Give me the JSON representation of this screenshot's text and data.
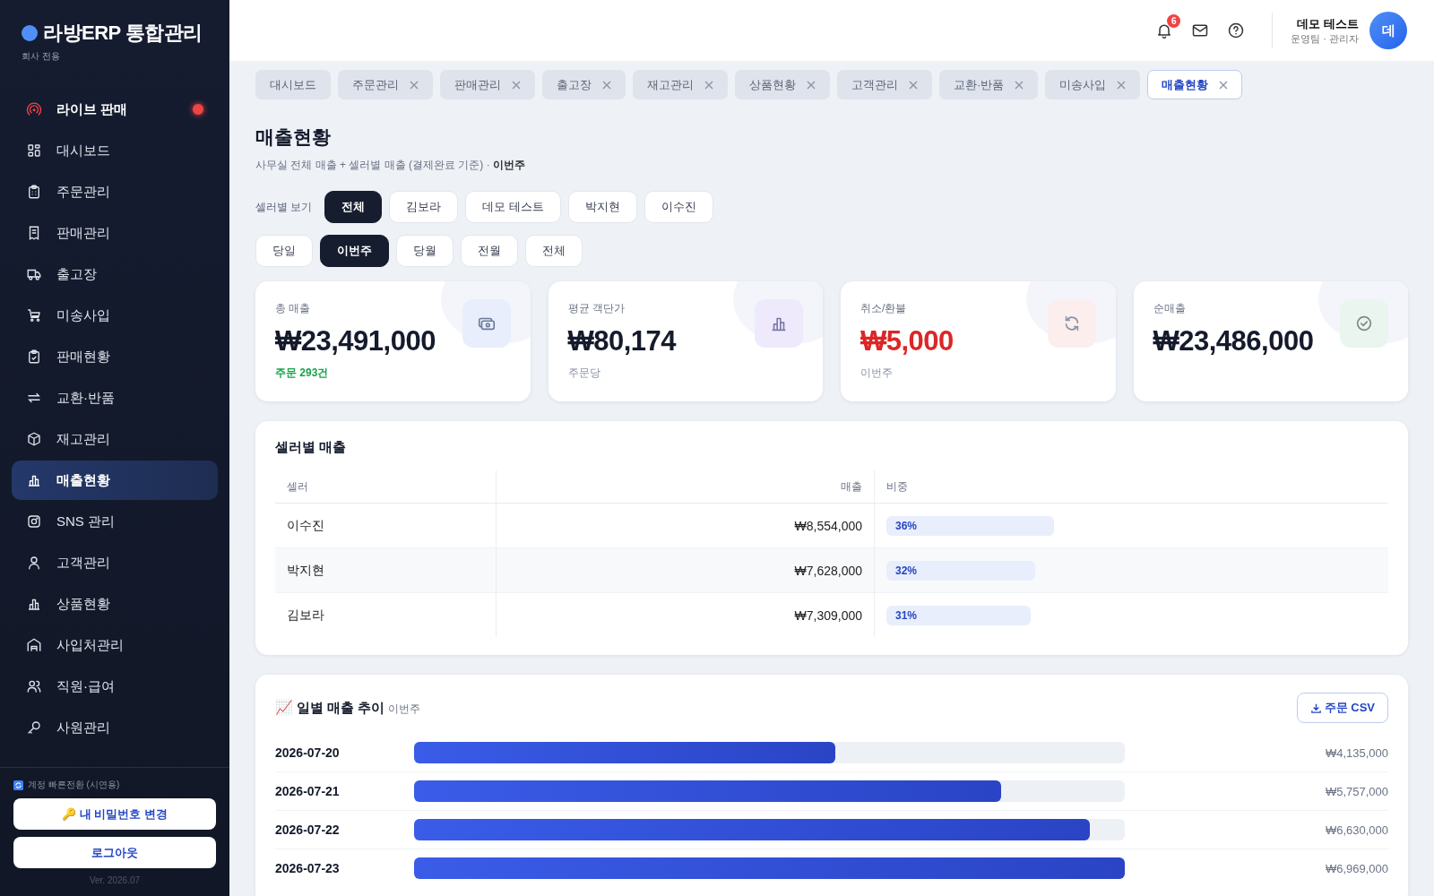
{
  "sidebar": {
    "brand": "라방ERP 통합관리",
    "subtitle": "회사 전용",
    "items": [
      {
        "label": "라이브 판매",
        "kind": "live",
        "selected": false,
        "live": true
      },
      {
        "label": "대시보드",
        "kind": "grid",
        "selected": false
      },
      {
        "label": "주문관리",
        "kind": "clipboard",
        "selected": false
      },
      {
        "label": "판매관리",
        "kind": "receipt",
        "selected": false
      },
      {
        "label": "출고장",
        "kind": "truck",
        "selected": false
      },
      {
        "label": "미송사입",
        "kind": "cart",
        "selected": false
      },
      {
        "label": "판매현황",
        "kind": "check",
        "selected": false
      },
      {
        "label": "교환·반품",
        "kind": "swap",
        "selected": false
      },
      {
        "label": "재고관리",
        "kind": "box",
        "selected": false
      },
      {
        "label": "매출현황",
        "kind": "chart",
        "selected": true
      },
      {
        "label": "SNS 관리",
        "kind": "camera",
        "selected": false
      },
      {
        "label": "고객관리",
        "kind": "person",
        "selected": false
      },
      {
        "label": "상품현황",
        "kind": "chart",
        "selected": false
      },
      {
        "label": "사입처관리",
        "kind": "store",
        "selected": false
      },
      {
        "label": "직원·급여",
        "kind": "people",
        "selected": false
      },
      {
        "label": "사원관리",
        "kind": "key",
        "selected": false
      }
    ],
    "switch_label": "계정 빠른전환 (시연용)",
    "password_button": "🔑 내 비밀번호 변경",
    "logout_button": "로그아웃",
    "version": "Ver. 2026.07"
  },
  "topbar": {
    "notification_count": "6",
    "user_name": "데모 테스트",
    "user_role": "운영팀 · 관리자",
    "avatar": "데"
  },
  "tabs": [
    {
      "label": "대시보드",
      "closable": false,
      "selected": false
    },
    {
      "label": "주문관리",
      "closable": true,
      "selected": false
    },
    {
      "label": "판매관리",
      "closable": true,
      "selected": false
    },
    {
      "label": "출고장",
      "closable": true,
      "selected": false
    },
    {
      "label": "재고관리",
      "closable": true,
      "selected": false
    },
    {
      "label": "상품현황",
      "closable": true,
      "selected": false
    },
    {
      "label": "고객관리",
      "closable": true,
      "selected": false
    },
    {
      "label": "교환·반품",
      "closable": true,
      "selected": false
    },
    {
      "label": "미송사입",
      "closable": true,
      "selected": false
    },
    {
      "label": "매출현황",
      "closable": true,
      "selected": true
    }
  ],
  "page": {
    "title": "매출현황",
    "subtitle": "사무실 전체 매출 + 셀러별 매출 (결제완료 기준) · **이번주**"
  },
  "seller_filter": {
    "label": "셀러별 보기",
    "options": [
      {
        "label": "전체",
        "selected": true
      },
      {
        "label": "김보라",
        "selected": false
      },
      {
        "label": "데모 테스트",
        "selected": false
      },
      {
        "label": "박지현",
        "selected": false
      },
      {
        "label": "이수진",
        "selected": false
      }
    ]
  },
  "period_filter": [
    {
      "label": "당일",
      "selected": false
    },
    {
      "label": "이번주",
      "selected": true
    },
    {
      "label": "당월",
      "selected": false
    },
    {
      "label": "전월",
      "selected": false
    },
    {
      "label": "전체",
      "selected": false
    }
  ],
  "cards": [
    {
      "kind": "total",
      "label": "총 매출",
      "value": "₩23,491,000",
      "note": "주문 293건"
    },
    {
      "kind": "average",
      "label": "평균 객단가",
      "value": "₩80,174",
      "note": "주문당"
    },
    {
      "kind": "refund",
      "label": "취소/환불",
      "value": "₩5,000",
      "note": "이번주"
    },
    {
      "kind": "net",
      "label": "순매출",
      "value": "₩23,486,000"
    }
  ],
  "seller_table": {
    "title": "셀러별 매출",
    "columns": [
      "셀러",
      "매출",
      "비중"
    ],
    "rows": [
      {
        "seller": "이수진",
        "sales": "₩8,554,000",
        "share": "36%"
      },
      {
        "seller": "박지현",
        "sales": "₩7,628,000",
        "share": "32%"
      },
      {
        "seller": "김보라",
        "sales": "₩7,309,000",
        "share": "31%"
      }
    ]
  },
  "daily": {
    "icon": "📈",
    "title": "일별 매출 추이",
    "period": "이번주",
    "export_button": "주문 CSV",
    "rows": [
      {
        "date": "2026-07-20",
        "level": 0.593,
        "amount": "₩4,135,000"
      },
      {
        "date": "2026-07-21",
        "level": 0.826,
        "amount": "₩5,757,000"
      },
      {
        "date": "2026-07-22",
        "level": 0.951,
        "amount": "₩6,630,000"
      },
      {
        "date": "2026-07-23",
        "level": 1.0,
        "amount": "₩6,969,000"
      }
    ]
  }
}
